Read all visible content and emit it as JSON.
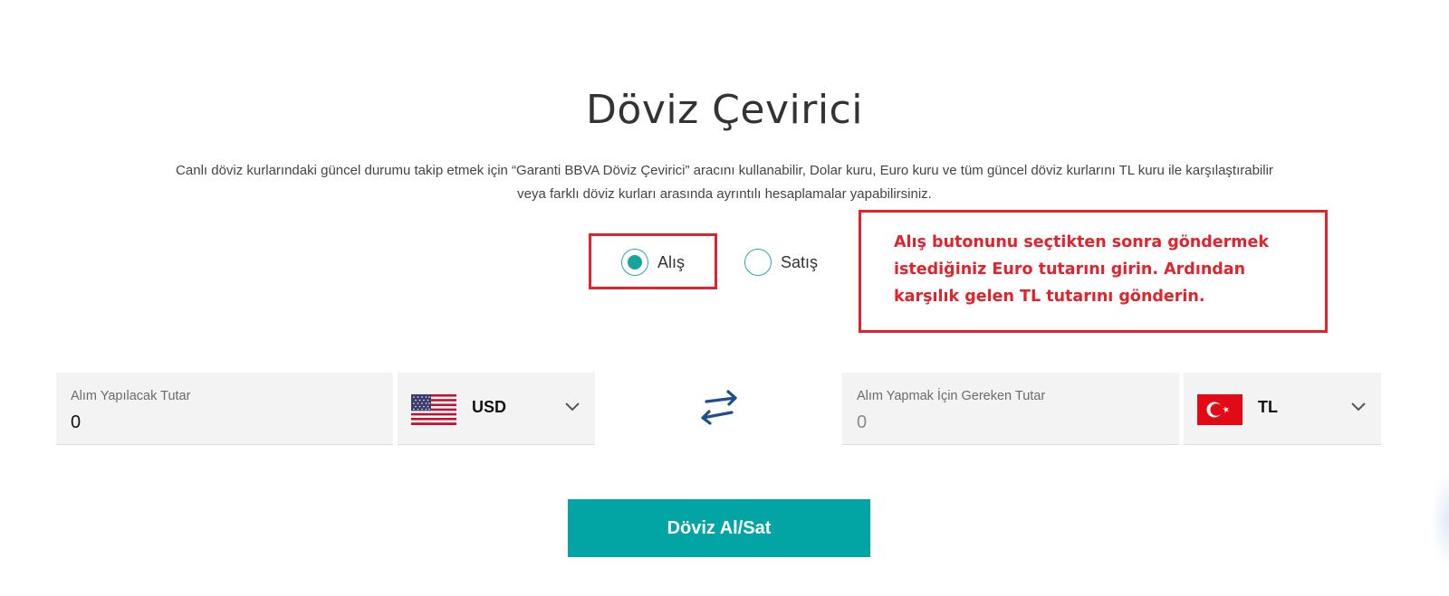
{
  "page": {
    "title": "Döviz Çevirici",
    "description_line1": "Canlı döviz kurlarındaki güncel durumu takip etmek için “Garanti BBVA Döviz Çevirici” aracını kullanabilir, Dolar kuru, Euro kuru ve tüm güncel döviz kurlarını TL kuru ile karşılaştırabilir",
    "description_line2": "veya farklı döviz kurları arasında ayrıntılı hesaplamalar yapabilirsiniz."
  },
  "mode": {
    "buy_label": "Alış",
    "sell_label": "Satış",
    "selected": "Alış"
  },
  "annotation": {
    "note": "Alış butonunu seçtikten sonra göndermek istediğiniz Euro tutarını girin. Ardından karşılık gelen TL tutarını gönderin.",
    "color": "#e2232b"
  },
  "converter": {
    "from": {
      "label": "Alım Yapılacak Tutar",
      "value": "0",
      "currency": "USD",
      "flag_icon": "us-flag-icon"
    },
    "to": {
      "label": "Alım Yapmak İçin Gereken Tutar",
      "value": "0",
      "currency": "TL",
      "flag_icon": "tr-flag-icon"
    },
    "swap_icon": "swap-arrows-icon"
  },
  "action": {
    "submit_label": "Döviz Al/Sat",
    "color": "#03a5a4"
  }
}
